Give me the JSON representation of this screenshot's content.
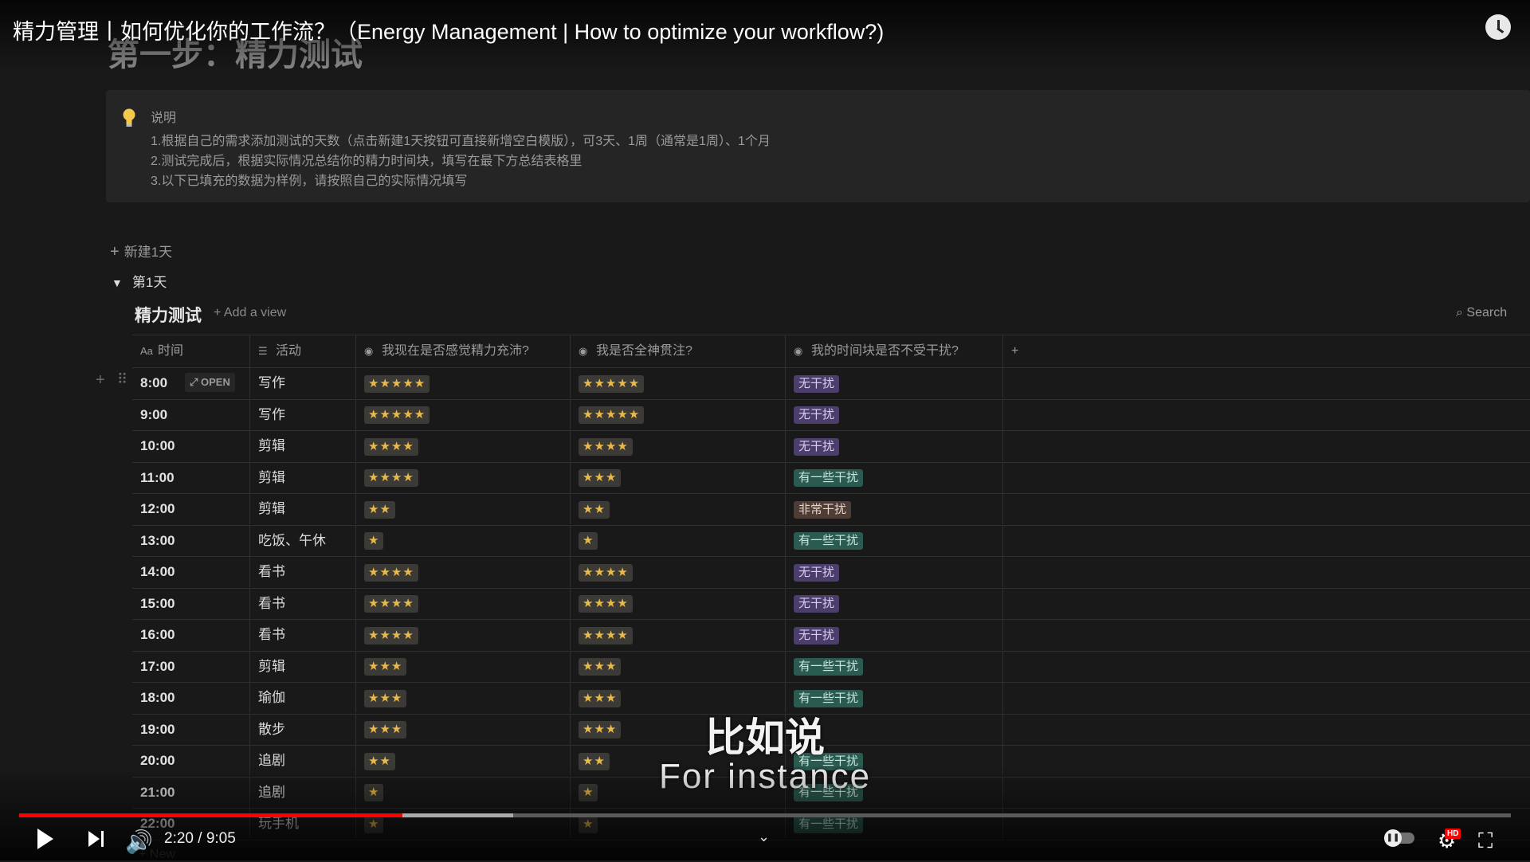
{
  "video": {
    "title": "精力管理丨如何优化你的工作流？（Energy Management | How to optimize your workflow?)",
    "current_time": "2:20",
    "duration": "9:05",
    "time_display": "2:20 / 9:05",
    "progress_fraction": 0.257,
    "buffered_fraction": 0.331,
    "subtitle_cn": "比如说",
    "subtitle_en": "For instance",
    "hd_label": "HD"
  },
  "page": {
    "heading": "第一步：精力测试",
    "callout": {
      "title": "说明",
      "lines": [
        "1.根据自己的需求添加测试的天数（点击新建1天按钮可直接新增空白模版），可3天、1周（通常是1周）、1个月",
        "2.测试完成后，根据实际情况总结你的精力时间块，填写在最下方总结表格里",
        "3.以下已填充的数据为样例，请按照自己的实际情况填写"
      ]
    },
    "new_day_label": "新建1天",
    "toggle_label": "第1天"
  },
  "database": {
    "title": "精力测试",
    "add_view_label": "Add a view",
    "search_label": "Search",
    "open_label": "OPEN",
    "new_label": "New",
    "columns": [
      "时间",
      "活动",
      "我现在是否感觉精力充沛?",
      "我是否全神贯注?",
      "我的时间块是否不受干扰?"
    ],
    "rows": [
      {
        "time": "8:00",
        "activity": "写作",
        "energy": "★★★★★",
        "focus": "★★★★★",
        "interrupt": "无干扰"
      },
      {
        "time": "9:00",
        "activity": "写作",
        "energy": "★★★★★",
        "focus": "★★★★★",
        "interrupt": "无干扰"
      },
      {
        "time": "10:00",
        "activity": "剪辑",
        "energy": "★★★★",
        "focus": "★★★★",
        "interrupt": "无干扰"
      },
      {
        "time": "11:00",
        "activity": "剪辑",
        "energy": "★★★★",
        "focus": "★★★",
        "interrupt": "有一些干扰"
      },
      {
        "time": "12:00",
        "activity": "剪辑",
        "energy": "★★",
        "focus": "★★",
        "interrupt": "非常干扰"
      },
      {
        "time": "13:00",
        "activity": "吃饭、午休",
        "energy": "★",
        "focus": "★",
        "interrupt": "有一些干扰"
      },
      {
        "time": "14:00",
        "activity": "看书",
        "energy": "★★★★",
        "focus": "★★★★",
        "interrupt": "无干扰"
      },
      {
        "time": "15:00",
        "activity": "看书",
        "energy": "★★★★",
        "focus": "★★★★",
        "interrupt": "无干扰"
      },
      {
        "time": "16:00",
        "activity": "看书",
        "energy": "★★★★",
        "focus": "★★★★",
        "interrupt": "无干扰"
      },
      {
        "time": "17:00",
        "activity": "剪辑",
        "energy": "★★★",
        "focus": "★★★",
        "interrupt": "有一些干扰"
      },
      {
        "time": "18:00",
        "activity": "瑜伽",
        "energy": "★★★",
        "focus": "★★★",
        "interrupt": "有一些干扰"
      },
      {
        "time": "19:00",
        "activity": "散步",
        "energy": "★★★",
        "focus": "★★★",
        "interrupt": ""
      },
      {
        "time": "20:00",
        "activity": "追剧",
        "energy": "★★",
        "focus": "★★",
        "interrupt": "有一些干扰"
      },
      {
        "time": "21:00",
        "activity": "追剧",
        "energy": "★",
        "focus": "★",
        "interrupt": "有一些干扰"
      },
      {
        "time": "22:00",
        "activity": "玩手机",
        "energy": "★",
        "focus": "★",
        "interrupt": "有一些干扰"
      }
    ]
  },
  "tag_colors": {
    "无干扰": {
      "bg": "#4c3e6b",
      "fg": "#d9ccf2"
    },
    "有一些干扰": {
      "bg": "#2b5a50",
      "fg": "#c5e6dc"
    },
    "非常干扰": {
      "bg": "#4e3d36",
      "fg": "#e6d2c6"
    }
  },
  "icons": {
    "title_column": "text-format-icon",
    "text_column": "text-lines-icon",
    "select_column": "select-icon",
    "callout": "lightbulb-icon",
    "clock": "clock-icon"
  }
}
